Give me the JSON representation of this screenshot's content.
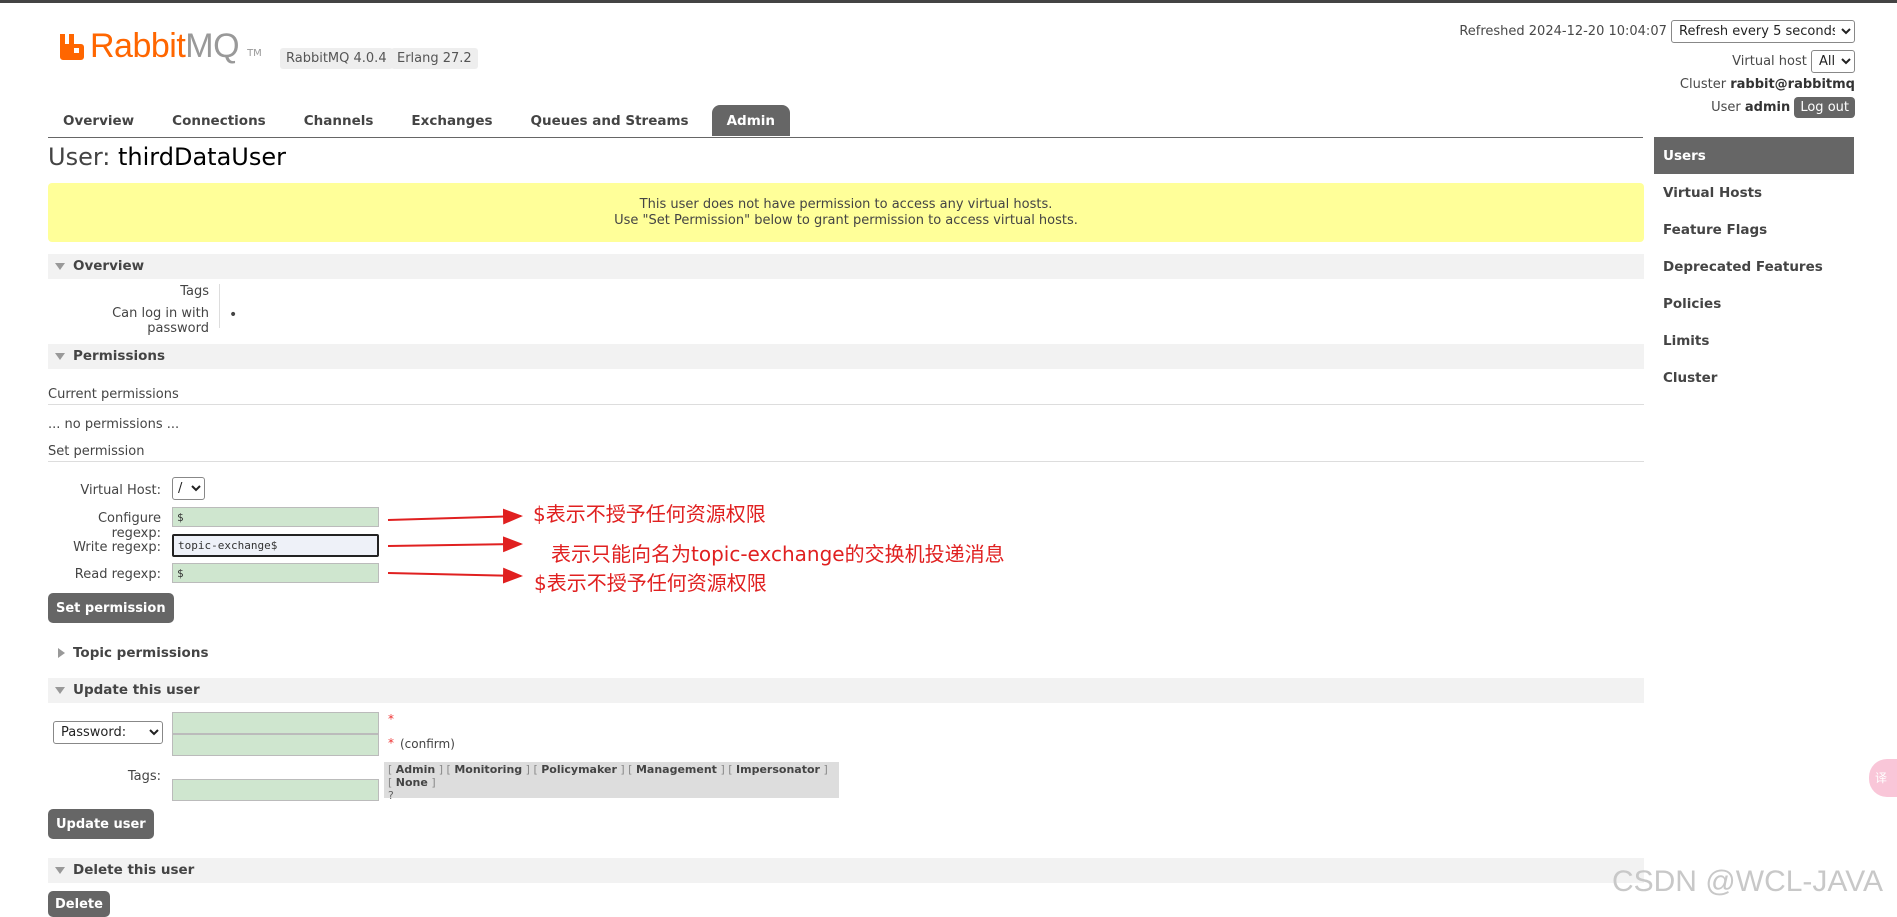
{
  "header": {
    "logo_brand": "Rabbit",
    "logo_mq": "MQ",
    "logo_tm": "TM",
    "rabbitmq_version": "RabbitMQ 4.0.4",
    "erlang_version": "Erlang 27.2",
    "refreshed_label": "Refreshed 2024-12-20 10:04:07",
    "refresh_select": "Refresh every 5 seconds",
    "vhost_label": "Virtual host",
    "vhost_select": "All",
    "cluster_label": "Cluster",
    "cluster_name": "rabbit@rabbitmq",
    "user_label": "User",
    "user_name": "admin",
    "logout_label": "Log out"
  },
  "nav": {
    "tabs": [
      {
        "label": "Overview"
      },
      {
        "label": "Connections"
      },
      {
        "label": "Channels"
      },
      {
        "label": "Exchanges"
      },
      {
        "label": "Queues and Streams"
      },
      {
        "label": "Admin",
        "active": true
      }
    ]
  },
  "sidebar": {
    "items": [
      {
        "label": "Users",
        "active": true
      },
      {
        "label": "Virtual Hosts"
      },
      {
        "label": "Feature Flags"
      },
      {
        "label": "Deprecated Features"
      },
      {
        "label": "Policies"
      },
      {
        "label": "Limits"
      },
      {
        "label": "Cluster"
      }
    ]
  },
  "page": {
    "title_prefix": "User:",
    "title_user": "thirdDataUser",
    "warning_line1": "This user does not have permission to access any virtual hosts.",
    "warning_line2": "Use \"Set Permission\" below to grant permission to access virtual hosts."
  },
  "overview": {
    "heading": "Overview",
    "tags_label": "Tags",
    "tags_value": "",
    "login_label": "Can log in with password",
    "login_value": "•"
  },
  "permissions": {
    "heading": "Permissions",
    "current_title": "Current permissions",
    "no_permissions": "... no permissions ...",
    "set_title": "Set permission",
    "vhost_label": "Virtual Host:",
    "vhost_value": "/",
    "configure_label": "Configure regexp:",
    "configure_value": "$",
    "write_label": "Write regexp:",
    "write_value": "topic-exchange$",
    "read_label": "Read regexp:",
    "read_value": "$",
    "set_button": "Set permission"
  },
  "annotations": {
    "configure_note": "$表示不授予任何资源权限",
    "write_note": "表示只能向名为topic-exchange的交换机投递消息",
    "read_note": "$表示不授予任何资源权限",
    "arrow_color": "#e02020"
  },
  "topic_permissions": {
    "heading": "Topic permissions"
  },
  "update_user": {
    "heading": "Update this user",
    "password_select": "Password:",
    "password_star": "*",
    "confirm_star": "*",
    "confirm_label": "(confirm)",
    "tags_label": "Tags:",
    "tag_options": [
      "Admin",
      "Monitoring",
      "Policymaker",
      "Management",
      "Impersonator",
      "None"
    ],
    "tags_help": "?",
    "update_button": "Update user"
  },
  "delete_user": {
    "heading": "Delete this user",
    "delete_button": "Delete"
  },
  "watermark": "CSDN @WCL-JAVA",
  "side_tab": "译"
}
